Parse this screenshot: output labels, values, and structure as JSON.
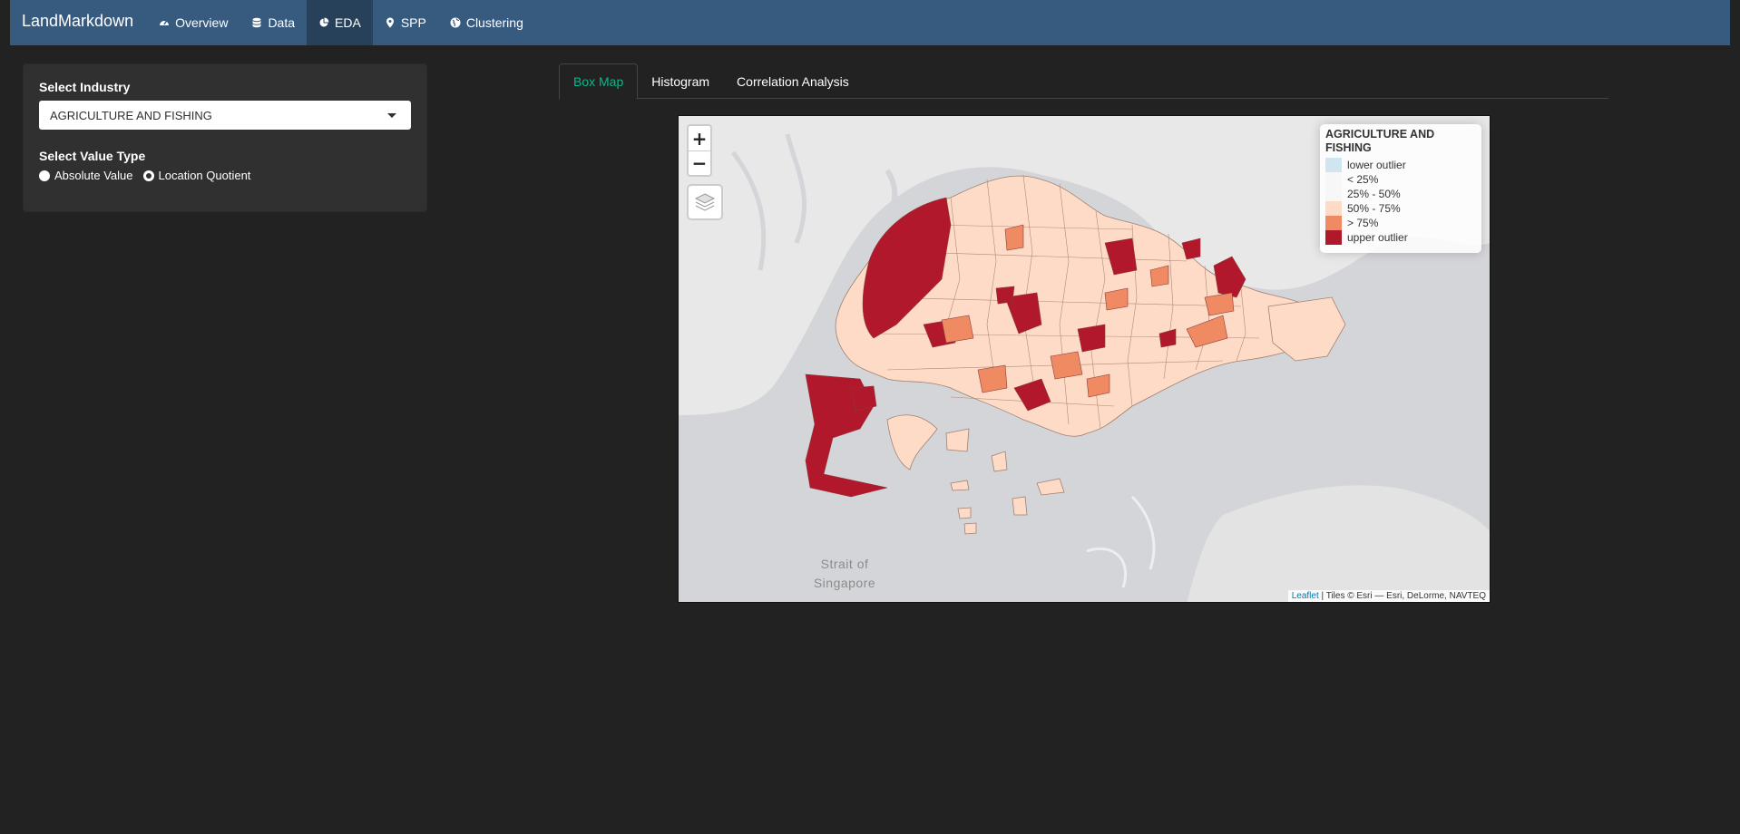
{
  "navbar": {
    "brand": "LandMarkdown",
    "items": [
      {
        "label": "Overview",
        "icon": "dashboard-icon",
        "active": false
      },
      {
        "label": "Data",
        "icon": "database-icon",
        "active": false
      },
      {
        "label": "EDA",
        "icon": "pie-chart-icon",
        "active": true
      },
      {
        "label": "SPP",
        "icon": "map-marker-icon",
        "active": false
      },
      {
        "label": "Clustering",
        "icon": "globe-icon",
        "active": false
      }
    ]
  },
  "sidebar": {
    "industry_label": "Select Industry",
    "industry_value": "AGRICULTURE AND FISHING",
    "value_type_label": "Select Value Type",
    "value_type_options": [
      "Absolute Value",
      "Location Quotient"
    ],
    "value_type_selected": "Absolute Value"
  },
  "tabs": [
    {
      "label": "Box Map",
      "active": true
    },
    {
      "label": "Histogram",
      "active": false
    },
    {
      "label": "Correlation Analysis",
      "active": false
    }
  ],
  "map": {
    "zoom_in": "+",
    "zoom_out": "−",
    "legend": {
      "title": "AGRICULTURE AND FISHING",
      "items": [
        {
          "label": "lower outlier",
          "color": "#d1e5f0"
        },
        {
          "label": "< 25%",
          "color": "#f7f7f7"
        },
        {
          "label": "25% - 50%",
          "color": "#f7f7f7"
        },
        {
          "label": "50% - 75%",
          "color": "#fddbc7"
        },
        {
          "label": "> 75%",
          "color": "#ef8a62"
        },
        {
          "label": "upper outlier",
          "color": "#b2182b"
        }
      ]
    },
    "sea_label_line1": "Strait of",
    "sea_label_line2": "Singapore",
    "attribution_link": "Leaflet",
    "attribution_text": " | Tiles © Esri — Esri, DeLorme, NAVTEQ"
  },
  "colors": {
    "navbar": "#375a7f",
    "navbar_active": "#28415b",
    "accent": "#00bc8c",
    "background": "#222222"
  }
}
